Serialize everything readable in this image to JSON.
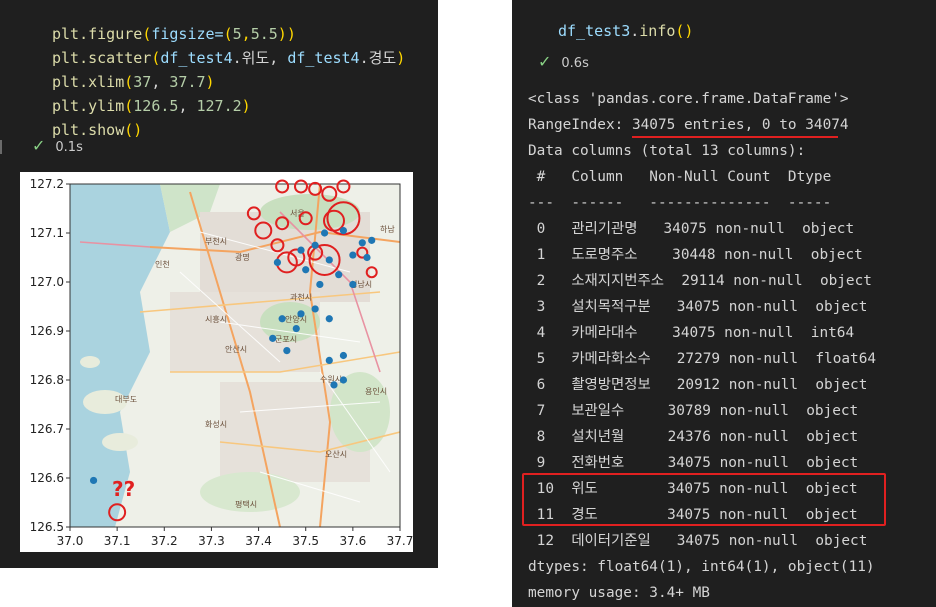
{
  "left_cell": {
    "code_lines": [
      {
        "parts": [
          [
            "plt.",
            "tok-fn"
          ],
          [
            "figure",
            "tok-fn"
          ],
          [
            "(",
            "tok-p"
          ],
          [
            "figsize=",
            "tok-var"
          ],
          [
            "(",
            "tok-p"
          ],
          [
            "5",
            "tok-num"
          ],
          [
            ",",
            "tok-p"
          ],
          [
            "5.5",
            "tok-num"
          ],
          [
            ")",
            "tok-p"
          ],
          [
            ")",
            "tok-p"
          ]
        ]
      },
      {
        "parts": [
          [
            "plt.",
            "tok-fn"
          ],
          [
            "scatter",
            "tok-fn"
          ],
          [
            "(",
            "tok-p"
          ],
          [
            "df_test4",
            "tok-var"
          ],
          [
            ".위도, ",
            ""
          ],
          [
            "df_test4",
            "tok-var"
          ],
          [
            ".경도",
            ""
          ],
          [
            ")",
            "tok-p"
          ]
        ]
      },
      {
        "parts": [
          [
            "plt.",
            "tok-fn"
          ],
          [
            "xlim",
            "tok-fn"
          ],
          [
            "(",
            "tok-p"
          ],
          [
            "37",
            "tok-num"
          ],
          [
            ", ",
            ""
          ],
          [
            "37.7",
            "tok-num"
          ],
          [
            ")",
            "tok-p"
          ]
        ]
      },
      {
        "parts": [
          [
            "plt.",
            "tok-fn"
          ],
          [
            "ylim",
            "tok-fn"
          ],
          [
            "(",
            "tok-p"
          ],
          [
            "126.5",
            "tok-num"
          ],
          [
            ", ",
            ""
          ],
          [
            "127.2",
            "tok-num"
          ],
          [
            ")",
            "tok-p"
          ]
        ]
      },
      {
        "parts": [
          [
            "plt.",
            "tok-fn"
          ],
          [
            "show",
            "tok-fn"
          ],
          [
            "(",
            "tok-p"
          ],
          [
            ")",
            "tok-p"
          ]
        ]
      }
    ],
    "status_time": "0.1s"
  },
  "chart_data": {
    "type": "scatter",
    "xlim": [
      37.0,
      37.7
    ],
    "ylim": [
      126.5,
      127.2
    ],
    "xticks": [
      "37.0",
      "37.1",
      "37.2",
      "37.3",
      "37.4",
      "37.5",
      "37.6",
      "37.7"
    ],
    "yticks": [
      "126.5",
      "126.6",
      "126.7",
      "126.8",
      "126.9",
      "127.0",
      "127.1",
      "127.2"
    ],
    "annotation": "??",
    "points": [
      {
        "x": 37.05,
        "y": 126.595
      },
      {
        "x": 37.44,
        "y": 127.04
      },
      {
        "x": 37.49,
        "y": 127.065
      },
      {
        "x": 37.52,
        "y": 127.075
      },
      {
        "x": 37.54,
        "y": 127.1
      },
      {
        "x": 37.58,
        "y": 127.105
      },
      {
        "x": 37.62,
        "y": 127.08
      },
      {
        "x": 37.64,
        "y": 127.085
      },
      {
        "x": 37.5,
        "y": 127.025
      },
      {
        "x": 37.55,
        "y": 127.045
      },
      {
        "x": 37.6,
        "y": 127.055
      },
      {
        "x": 37.63,
        "y": 127.05
      },
      {
        "x": 37.53,
        "y": 126.995
      },
      {
        "x": 37.57,
        "y": 127.015
      },
      {
        "x": 37.6,
        "y": 126.995
      },
      {
        "x": 37.49,
        "y": 126.935
      },
      {
        "x": 37.52,
        "y": 126.945
      },
      {
        "x": 37.45,
        "y": 126.925
      },
      {
        "x": 37.48,
        "y": 126.905
      },
      {
        "x": 37.55,
        "y": 126.925
      },
      {
        "x": 37.43,
        "y": 126.885
      },
      {
        "x": 37.46,
        "y": 126.86
      },
      {
        "x": 37.55,
        "y": 126.84
      },
      {
        "x": 37.58,
        "y": 126.85
      },
      {
        "x": 37.56,
        "y": 126.79
      },
      {
        "x": 37.58,
        "y": 126.8
      }
    ],
    "circles": [
      {
        "x": 37.45,
        "y": 127.195,
        "r": 6
      },
      {
        "x": 37.49,
        "y": 127.195,
        "r": 6
      },
      {
        "x": 37.52,
        "y": 127.19,
        "r": 6
      },
      {
        "x": 37.55,
        "y": 127.18,
        "r": 7
      },
      {
        "x": 37.58,
        "y": 127.195,
        "r": 6
      },
      {
        "x": 37.39,
        "y": 127.14,
        "r": 6
      },
      {
        "x": 37.41,
        "y": 127.105,
        "r": 8
      },
      {
        "x": 37.45,
        "y": 127.12,
        "r": 6
      },
      {
        "x": 37.5,
        "y": 127.13,
        "r": 6
      },
      {
        "x": 37.56,
        "y": 127.125,
        "r": 10
      },
      {
        "x": 37.58,
        "y": 127.13,
        "r": 16
      },
      {
        "x": 37.44,
        "y": 127.075,
        "r": 6
      },
      {
        "x": 37.46,
        "y": 127.04,
        "r": 10
      },
      {
        "x": 37.48,
        "y": 127.05,
        "r": 8
      },
      {
        "x": 37.52,
        "y": 127.06,
        "r": 7
      },
      {
        "x": 37.54,
        "y": 127.045,
        "r": 15
      },
      {
        "x": 37.62,
        "y": 127.06,
        "r": 5
      },
      {
        "x": 37.64,
        "y": 127.02,
        "r": 5
      },
      {
        "x": 37.1,
        "y": 126.53,
        "r": 8
      }
    ],
    "map_labels": [
      "서울",
      "부천시",
      "인천",
      "광명",
      "과천시",
      "안양시",
      "군포시",
      "시흥시",
      "안산시",
      "수원시",
      "성남시",
      "용인시",
      "화성시",
      "평택시",
      "오산시",
      "하남",
      "대부도"
    ]
  },
  "right_cell": {
    "code": "df_test3.info()",
    "status_time": "0.6s",
    "output_lines": [
      "<class 'pandas.core.frame.DataFrame'>",
      "RangeIndex: 34075 entries, 0 to 34074",
      "Data columns (total 13 columns):",
      " #   Column   Non-Null Count  Dtype",
      "---  ------   --------------  -----",
      " 0   관리기관명   34075 non-null  object",
      " 1   도로명주소    30448 non-null  object",
      " 2   소재지지번주소  29114 non-null  object",
      " 3   설치목적구분   34075 non-null  object",
      " 4   카메라대수    34075 non-null  int64",
      " 5   카메라화소수   27279 non-null  float64",
      " 6   촬영방면정보   20912 non-null  object",
      " 7   보관일수     30789 non-null  object",
      " 8   설치년월     24376 non-null  object",
      " 9   전화번호     34075 non-null  object",
      " 10  위도        34075 non-null  object",
      " 11  경도        34075 non-null  object",
      " 12  데이터기준일   34075 non-null  object",
      "dtypes: float64(1), int64(1), object(11)",
      "memory usage: 3.4+ MB"
    ]
  }
}
